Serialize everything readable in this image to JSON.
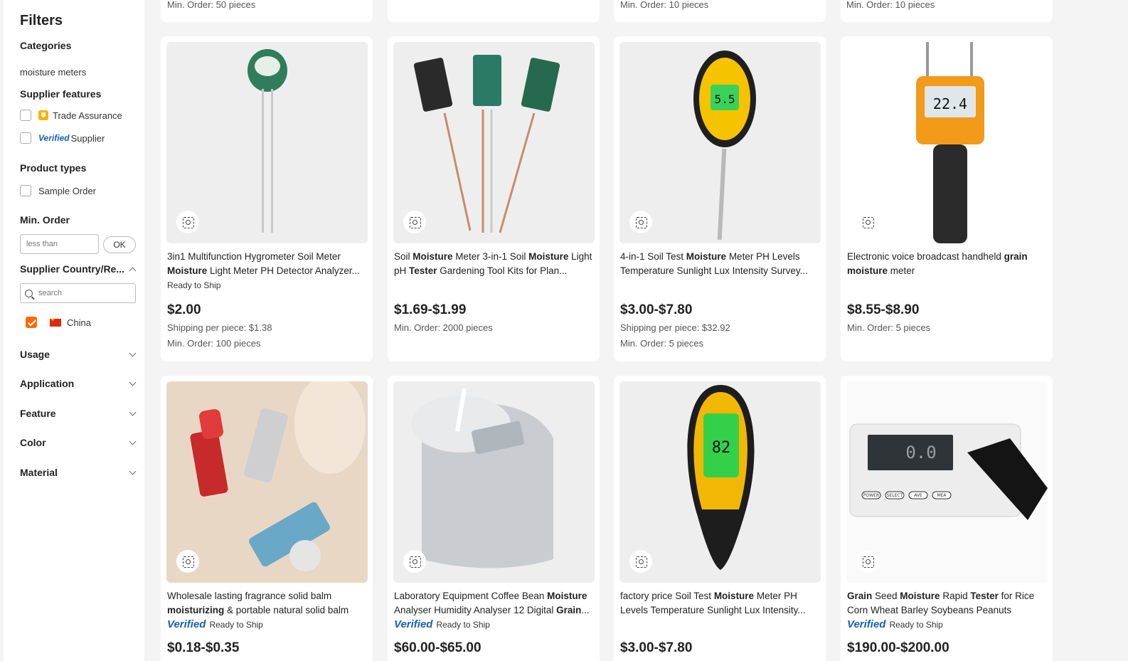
{
  "sidebar": {
    "title": "Filters",
    "categories_heading": "Categories",
    "category_value": "moisture meters",
    "supplier_features_heading": "Supplier features",
    "trade_assurance": "Trade Assurance",
    "verified_badge": "Verified",
    "verified_supplier": "Supplier",
    "product_types_heading": "Product types",
    "sample_order": "Sample Order",
    "min_order_heading": "Min. Order",
    "min_order_placeholder": "less than",
    "ok_label": "OK",
    "country_heading": "Supplier Country/Re...",
    "country_search_placeholder": "search",
    "country_china": "China",
    "china_checked": true,
    "collapsed_sections": [
      "Usage",
      "Application",
      "Feature",
      "Color",
      "Material"
    ]
  },
  "top_row": [
    "Min. Order: 50 pieces",
    "",
    "Min. Order: 10 pieces",
    "Min. Order: 10 pieces"
  ],
  "products": [
    {
      "title_html": "3in1 Multifunction Hygrometer Soil Meter <b>Moisture</b> Light Meter PH Detector Analyzer...",
      "ready": "Ready to Ship",
      "verified": false,
      "price": "$2.00",
      "line1": "Shipping per piece: $1.38",
      "line2": "Min. Order: 100 pieces",
      "image": "soil-meter-green"
    },
    {
      "title_html": "Soil <b>Moisture</b> Meter 3-in-1 Soil <b>Moisture</b> Light pH <b>Tester</b> Gardening Tool Kits for Plan...",
      "ready": "",
      "verified": false,
      "price": "$1.69-$1.99",
      "line1": "Min. Order: 2000 pieces",
      "line2": "",
      "image": "three-soil-meters"
    },
    {
      "title_html": "4-in-1 Soil Test <b>Moisture</b> Meter PH Levels Temperature Sunlight Lux Intensity Survey...",
      "ready": "",
      "verified": false,
      "price": "$3.00-$7.80",
      "line1": "Shipping per piece: $32.92",
      "line2": "Min. Order: 5 pieces",
      "image": "yellow-probe-meter"
    },
    {
      "title_html": "Electronic voice broadcast handheld <b>grain</b> <b>moisture</b> meter",
      "ready": "",
      "verified": false,
      "price": "$8.55-$8.90",
      "line1": "Min. Order: 5 pieces",
      "line2": "",
      "image": "grain-moisture-meter"
    },
    {
      "title_html": "Wholesale lasting fragrance solid balm <b>moisturizing</b> &amp; portable natural solid balm",
      "ready": "Ready to Ship",
      "verified": true,
      "price": "$0.18-$0.35",
      "image": "lipstick-balms"
    },
    {
      "title_html": "Laboratory Equipment Coffee Bean <b>Moisture</b> Analyser Humidity Analyser 12 Digital <b>Grain</b>...",
      "ready": "Ready to Ship",
      "verified": true,
      "price": "$60.00-$65.00",
      "image": "coffee-bean-analyser"
    },
    {
      "title_html": "factory price Soil Test <b>Moisture</b> Meter PH Levels Temperature Sunlight Lux Intensity...",
      "ready": "",
      "verified": false,
      "price": "$3.00-$7.80",
      "image": "green-lcd-meter"
    },
    {
      "title_html": "<b>Grain</b> Seed <b>Moisture</b> Rapid <b>Tester</b> for Rice Corn Wheat Barley Soybeans Peanuts Coffee...",
      "ready": "Ready to Ship",
      "verified": true,
      "price": "$190.00-$200.00",
      "image": "grain-seed-tester"
    }
  ],
  "image_labels": {
    "meter_readout_1": "5.5",
    "meter_readout_2": "22.4",
    "meter_readout_3": "82",
    "meter_readout_4": "0.0",
    "grain_buttons": [
      "POWER",
      "SELECT",
      "AVE",
      "MEA"
    ]
  },
  "colors": {
    "accent": "#ff6a00",
    "verified_blue": "#1a5db5",
    "card_bg": "#ffffff",
    "page_bg": "#f4f4f4"
  }
}
